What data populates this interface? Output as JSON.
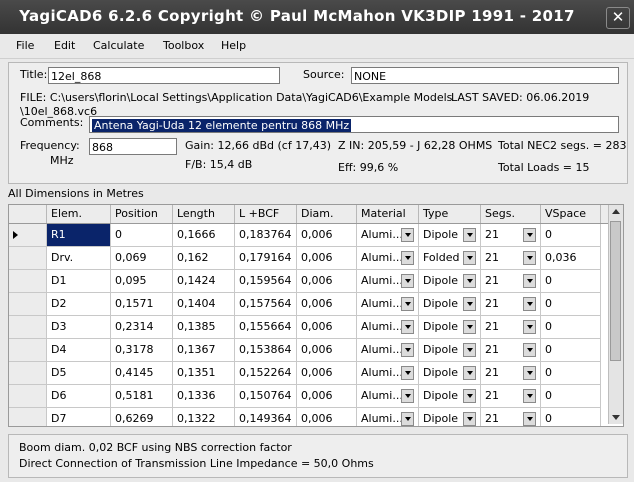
{
  "window": {
    "title": "YagiCAD6 6.2.6   Copyright © Paul McMahon VK3DIP 1991 - 2017",
    "close_glyph": "✕"
  },
  "menu": [
    "File",
    "Edit",
    "Calculate",
    "Toolbox",
    "Help"
  ],
  "info": {
    "title_label": "Title:",
    "title_value": "12el_868",
    "source_label": "Source:",
    "source_value": "NONE",
    "file_line1": "FILE: C:\\users\\florin\\Local Settings\\Application Data\\YagiCAD6\\Example Models",
    "file_line2": "\\10el_868.vc6",
    "last_saved": "LAST SAVED: 06.06.2019",
    "comments_label": "Comments:",
    "comments_value": "Antena Yagi-Uda 12 elemente pentru 868 MHz",
    "frequency_label": "Frequency:",
    "frequency_unit": "MHz",
    "frequency_value": "868",
    "gain": "Gain: 12,66 dBd (cf 17,43)",
    "fb": "F/B: 15,4 dB",
    "zin": "Z IN: 205,59 - J 62,28 OHMS",
    "eff": "Eff: 99,6 %",
    "nec2": "Total NEC2 segs. = 283",
    "loads": "Total Loads = 15"
  },
  "dimensions_label": "All Dimensions in Metres",
  "table": {
    "columns": [
      "Elem.",
      "Position",
      "Length",
      "L +BCF",
      "Diam.",
      "Material",
      "Type",
      "Segs.",
      "VSpace"
    ],
    "rows": [
      [
        "R1",
        "0",
        "0,1666",
        "0,183764",
        "0,006",
        "Alumi...",
        "Dipole",
        "21",
        "0"
      ],
      [
        "Drv.",
        "0,069",
        "0,162",
        "0,179164",
        "0,006",
        "Alumi...",
        "Folded",
        "21",
        "0,036"
      ],
      [
        "D1",
        "0,095",
        "0,1424",
        "0,159564",
        "0,006",
        "Alumi...",
        "Dipole",
        "21",
        "0"
      ],
      [
        "D2",
        "0,1571",
        "0,1404",
        "0,157564",
        "0,006",
        "Alumi...",
        "Dipole",
        "21",
        "0"
      ],
      [
        "D3",
        "0,2314",
        "0,1385",
        "0,155664",
        "0,006",
        "Alumi...",
        "Dipole",
        "21",
        "0"
      ],
      [
        "D4",
        "0,3178",
        "0,1367",
        "0,153864",
        "0,006",
        "Alumi...",
        "Dipole",
        "21",
        "0"
      ],
      [
        "D5",
        "0,4145",
        "0,1351",
        "0,152264",
        "0,006",
        "Alumi...",
        "Dipole",
        "21",
        "0"
      ],
      [
        "D6",
        "0,5181",
        "0,1336",
        "0,150764",
        "0,006",
        "Alumi...",
        "Dipole",
        "21",
        "0"
      ],
      [
        "D7",
        "0,6269",
        "0,1322",
        "0,149364",
        "0,006",
        "Alumi...",
        "Dipole",
        "21",
        "0"
      ]
    ]
  },
  "footer": {
    "line1": "Boom diam.  0,02  BCF using NBS correction factor",
    "line2": "Direct Connection of Transmission Line Impedance =  50,0 Ohms"
  },
  "colors": {
    "titlebar": "#3c3c3c",
    "selection": "#0a246a"
  }
}
